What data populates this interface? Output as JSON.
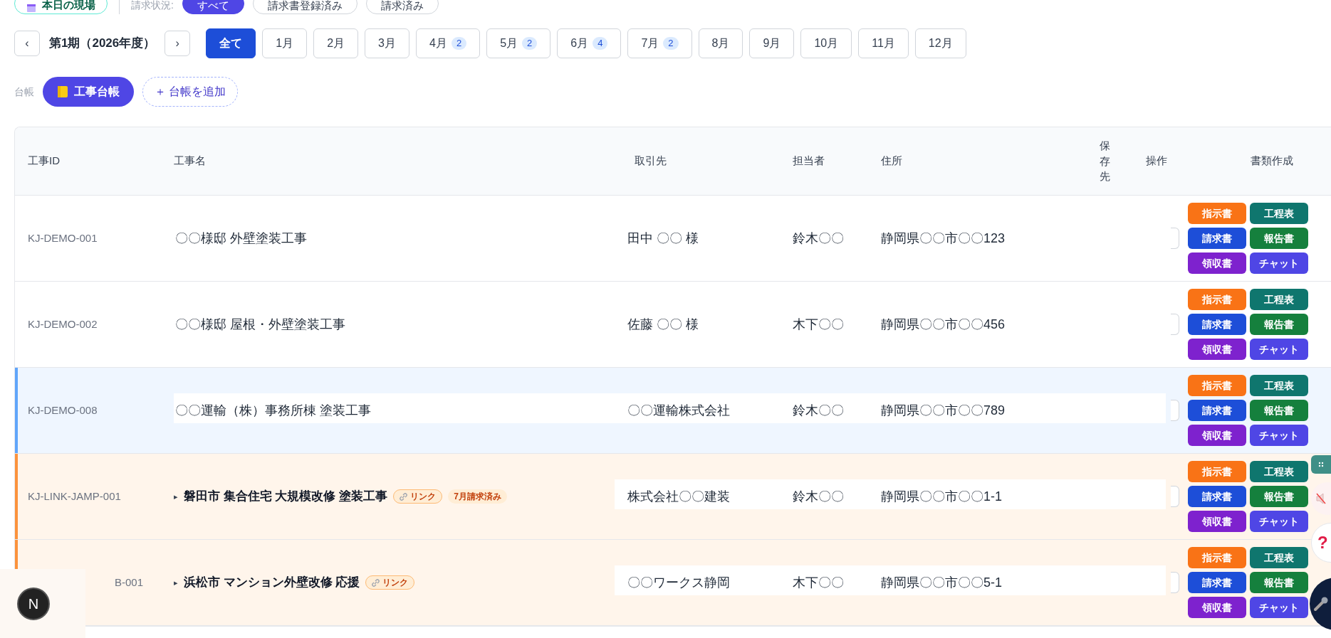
{
  "filters": {
    "today_badge": "本日の現場",
    "billing_label": "請求状況:",
    "billing_options": [
      {
        "label": "すべて",
        "selected": true
      },
      {
        "label": "請求書登録済み",
        "selected": false
      },
      {
        "label": "請求済み",
        "selected": false
      }
    ]
  },
  "period": {
    "prev": "‹",
    "label": "第1期（2026年度）",
    "next": "›",
    "months": [
      {
        "label": "全て",
        "selected": true
      },
      {
        "label": "1月",
        "selected": false
      },
      {
        "label": "2月",
        "selected": false
      },
      {
        "label": "3月",
        "selected": false
      },
      {
        "label": "4月",
        "count": "2",
        "selected": false
      },
      {
        "label": "5月",
        "count": "2",
        "selected": false
      },
      {
        "label": "6月",
        "count": "4",
        "selected": false
      },
      {
        "label": "7月",
        "count": "2",
        "selected": false
      },
      {
        "label": "8月",
        "selected": false
      },
      {
        "label": "9月",
        "selected": false
      },
      {
        "label": "10月",
        "selected": false
      },
      {
        "label": "11月",
        "selected": false
      },
      {
        "label": "12月",
        "selected": false
      }
    ]
  },
  "ledgers": {
    "label": "台帳",
    "items": [
      {
        "label": "工事台帳",
        "selected": true
      }
    ],
    "add": "＋ 台帳を追加"
  },
  "table": {
    "columns": [
      "工事ID",
      "工事名",
      "取引先",
      "担当者",
      "住所",
      "保存先",
      "操作",
      "書類作成"
    ],
    "rows": [
      {
        "id": "KJ-DEMO-001",
        "name": "〇〇様邸 外壁塗装工事",
        "client": "田中 〇〇 様",
        "person": "鈴木〇〇",
        "address": "静岡県〇〇市〇〇123",
        "selected": false,
        "linked": false,
        "documents": [
          {
            "label": "指示書",
            "color": "#f97316"
          },
          {
            "label": "工程表",
            "color": "#0f766e"
          },
          {
            "label": "請求書",
            "color": "#1d4ed8"
          },
          {
            "label": "報告書",
            "color": "#15803d"
          },
          {
            "label": "領収書",
            "color": "#7e22ce"
          },
          {
            "label": "チャット",
            "color": "#4f46e5"
          }
        ]
      },
      {
        "id": "KJ-DEMO-002",
        "name": "〇〇様邸 屋根・外壁塗装工事",
        "client": "佐藤 〇〇 様",
        "person": "木下〇〇",
        "address": "静岡県〇〇市〇〇456",
        "selected": false,
        "linked": false,
        "documents": [
          {
            "label": "指示書",
            "color": "#f97316"
          },
          {
            "label": "工程表",
            "color": "#0f766e"
          },
          {
            "label": "請求書",
            "color": "#1d4ed8"
          },
          {
            "label": "報告書",
            "color": "#15803d"
          },
          {
            "label": "領収書",
            "color": "#7e22ce"
          },
          {
            "label": "チャット",
            "color": "#4f46e5"
          }
        ]
      },
      {
        "id": "KJ-DEMO-008",
        "name": "〇〇運輸（株）事務所棟 塗装工事",
        "client": "〇〇運輸株式会社",
        "person": "鈴木〇〇",
        "address": "静岡県〇〇市〇〇789",
        "selected": true,
        "linked": false,
        "documents": [
          {
            "label": "指示書",
            "color": "#f97316"
          },
          {
            "label": "工程表",
            "color": "#0f766e"
          },
          {
            "label": "請求書",
            "color": "#1d4ed8"
          },
          {
            "label": "報告書",
            "color": "#15803d"
          },
          {
            "label": "領収書",
            "color": "#7e22ce"
          },
          {
            "label": "チャット",
            "color": "#4f46e5"
          }
        ]
      },
      {
        "id": "KJ-LINK-JAMP-001",
        "name": "磐田市 集合住宅 大規模改修 塗装工事",
        "client": "株式会社〇〇建装",
        "person": "鈴木〇〇",
        "address": "静岡県〇〇市〇〇1-1",
        "selected": false,
        "linked": true,
        "caret": "▸",
        "link_badge": "リンク",
        "billing_badge": "7月請求済み",
        "documents": [
          {
            "label": "指示書",
            "color": "#f97316"
          },
          {
            "label": "工程表",
            "color": "#0f766e"
          },
          {
            "label": "請求書",
            "color": "#1d4ed8"
          },
          {
            "label": "報告書",
            "color": "#15803d"
          },
          {
            "label": "領収書",
            "color": "#7e22ce"
          },
          {
            "label": "チャット",
            "color": "#4f46e5"
          }
        ]
      },
      {
        "id": "B-001",
        "name": "浜松市 マンション外壁改修 応援",
        "client": "〇〇ワークス静岡",
        "person": "木下〇〇",
        "address": "静岡県〇〇市〇〇5-1",
        "selected": false,
        "linked": true,
        "caret": "▸",
        "link_badge": "リンク",
        "documents": [
          {
            "label": "指示書",
            "color": "#f97316"
          },
          {
            "label": "工程表",
            "color": "#0f766e"
          },
          {
            "label": "請求書",
            "color": "#1d4ed8"
          },
          {
            "label": "報告書",
            "color": "#15803d"
          },
          {
            "label": "領収書",
            "color": "#7e22ce"
          },
          {
            "label": "チャット",
            "color": "#4f46e5"
          }
        ]
      }
    ]
  },
  "floating": {
    "help": "?",
    "dev_badge": "N"
  }
}
